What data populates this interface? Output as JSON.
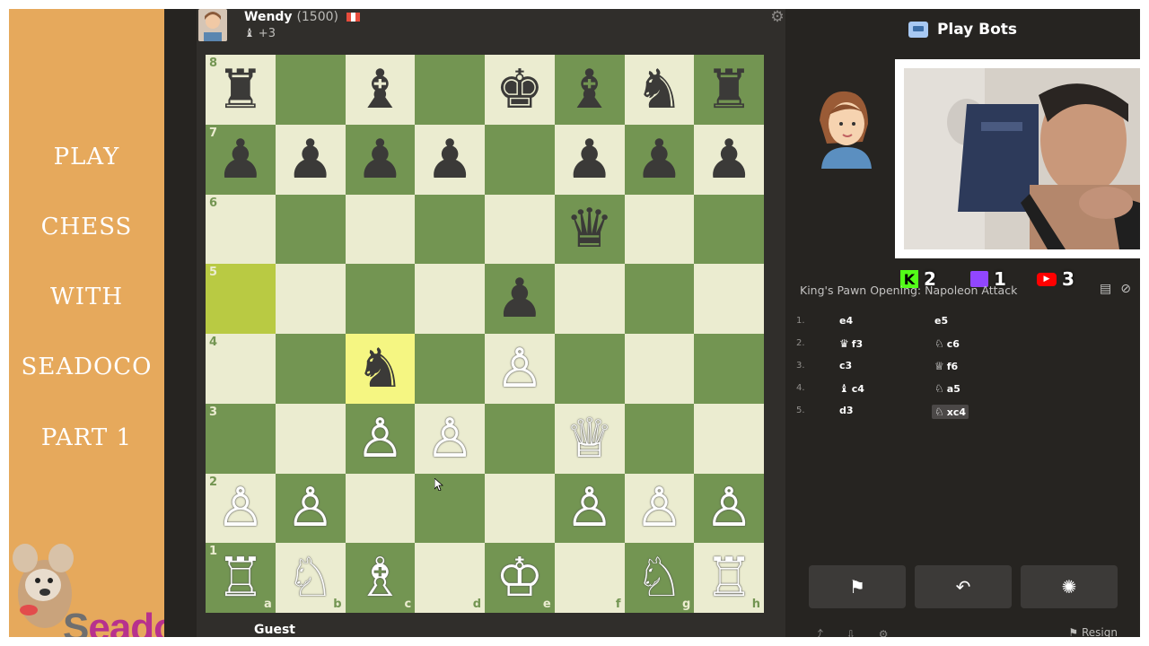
{
  "overlay": {
    "title_lines": [
      "PLAY",
      "CHESS",
      "WITH",
      "SEADOCO",
      "PART 1"
    ],
    "brand_first": "S",
    "brand_rest": "eadoco"
  },
  "top_player": {
    "name": "Wendy",
    "rating": "(1500)",
    "captured": "+3"
  },
  "bottom_player": {
    "name": "Guest"
  },
  "board": {
    "rank_labels": [
      "8",
      "7",
      "6",
      "5",
      "4",
      "3",
      "2",
      "1"
    ],
    "file_labels": [
      "a",
      "b",
      "c",
      "d",
      "e",
      "f",
      "g",
      "h"
    ],
    "rows": [
      [
        "♜",
        "",
        "♝",
        "",
        "♚",
        "♝",
        "♞",
        "♜"
      ],
      [
        "♟",
        "♟",
        "♟",
        "♟",
        "",
        "♟",
        "♟",
        "♟"
      ],
      [
        "",
        "",
        "",
        "",
        "",
        "♛",
        "",
        ""
      ],
      [
        "",
        "",
        "",
        "",
        "♟",
        "",
        "",
        ""
      ],
      [
        "",
        "",
        "♞",
        "",
        "♙",
        "",
        "",
        ""
      ],
      [
        "",
        "",
        "♙",
        "♙",
        "",
        "♕",
        "",
        ""
      ],
      [
        "♙",
        "♙",
        "",
        "",
        "",
        "♙",
        "♙",
        "♙"
      ],
      [
        "♖",
        "♘",
        "♗",
        "",
        "♔",
        "",
        "♘",
        "♖"
      ]
    ]
  },
  "right_panel": {
    "title": "Play Bots",
    "stats": {
      "kick": "2",
      "twitch": "1",
      "youtube": "3"
    },
    "opening": "King's Pawn Opening: Napoleon Attack",
    "moves": [
      {
        "num": "1.",
        "white": "e4",
        "white_icon": "",
        "black": "e5",
        "black_icon": ""
      },
      {
        "num": "2.",
        "white": "f3",
        "white_icon": "♛",
        "black": "c6",
        "black_icon": "♘"
      },
      {
        "num": "3.",
        "white": "c3",
        "white_icon": "",
        "black": "f6",
        "black_icon": "♕"
      },
      {
        "num": "4.",
        "white": "c4",
        "white_icon": "♝",
        "black": "a5",
        "black_icon": "♘"
      },
      {
        "num": "5.",
        "white": "d3",
        "white_icon": "",
        "black": "xc4",
        "black_icon": "♘"
      }
    ],
    "footer_resign": "Resign"
  }
}
